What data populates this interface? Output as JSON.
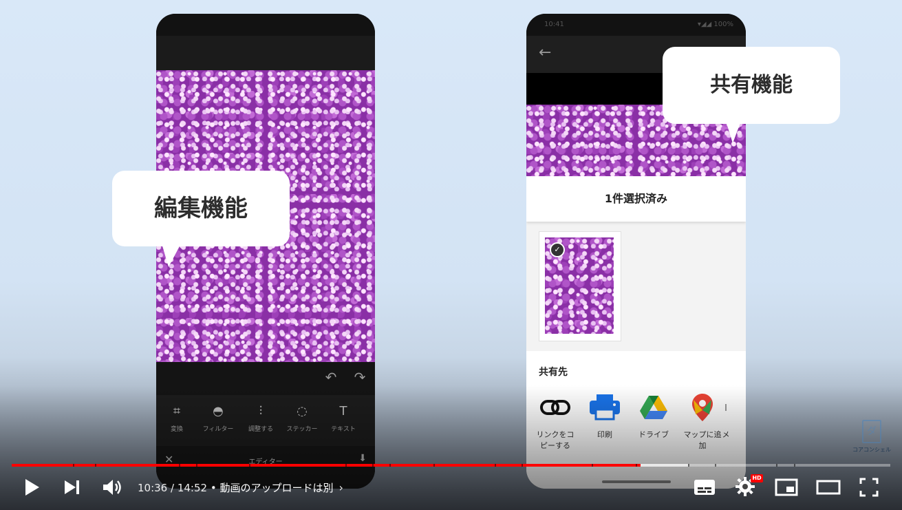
{
  "left_phone": {
    "callout": "編集機能",
    "tools": [
      {
        "label": "変換",
        "icon": "crop-rotate-icon",
        "glyph": "⌗"
      },
      {
        "label": "フィルター",
        "icon": "filter-icon",
        "glyph": "◓"
      },
      {
        "label": "調整する",
        "icon": "adjust-sliders-icon",
        "glyph": "⫶"
      },
      {
        "label": "ステッカー",
        "icon": "sticker-icon",
        "glyph": "◌"
      },
      {
        "label": "テキスト",
        "icon": "text-icon",
        "glyph": "T"
      }
    ],
    "footer_title": "エディター",
    "undo_glyph": "↶",
    "redo_glyph": "↷",
    "close_glyph": "✕",
    "download_glyph": "⬇"
  },
  "right_phone": {
    "callout": "共有機能",
    "status_time": "10:41",
    "status_right": "▾◢◢ 100%",
    "back_glyph": "←",
    "selected_title": "1件選択済み",
    "share_section_title": "共有先",
    "share_targets": [
      {
        "label": "リンクをコピーする",
        "icon": "link-icon"
      },
      {
        "label": "印刷",
        "icon": "printer-icon"
      },
      {
        "label": "ドライブ",
        "icon": "google-drive-icon"
      },
      {
        "label": "マップに追加",
        "icon": "maps-pin-icon"
      },
      {
        "label": "メ",
        "icon": "more-icon"
      }
    ]
  },
  "watermark": {
    "name": "コアコンシェル",
    "logo_glyph": "ダ"
  },
  "player": {
    "time_current": "10:36",
    "time_total": "14:52",
    "time_separator": " / ",
    "chapter_separator": " • ",
    "chapter_title": "動画のアップロードは別",
    "chevron": "›",
    "hd_label": "HD",
    "progress": {
      "played": 0.716,
      "buffered": 0.77
    },
    "chapter_breaks": [
      0.07,
      0.095,
      0.19,
      0.21,
      0.27,
      0.38,
      0.41,
      0.43,
      0.48,
      0.55,
      0.58,
      0.66,
      0.71,
      0.77,
      0.8,
      0.87,
      0.89
    ]
  },
  "colors": {
    "progress": "#ff0000",
    "bubble": "#ffffff",
    "background": "#d7e6f6"
  }
}
